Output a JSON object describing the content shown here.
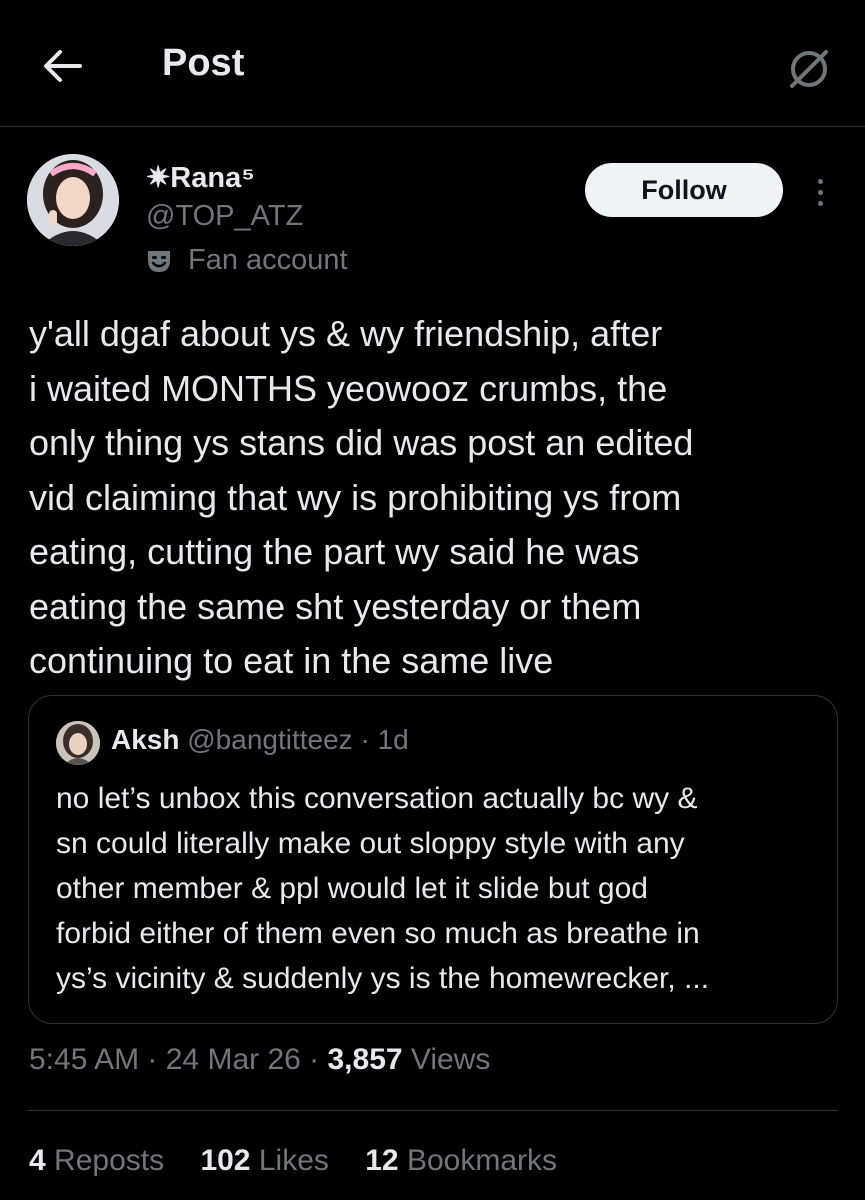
{
  "header": {
    "title": "Post",
    "back_icon": "arrow-left-icon",
    "grok_icon": "grok-icon"
  },
  "author": {
    "display_name": "✷Rana⁵",
    "handle": "@TOP_ATZ",
    "label_icon": "fan-mask-icon",
    "label": "Fan account",
    "follow_label": "Follow",
    "more_icon": "more-vertical-icon"
  },
  "post": {
    "lines": [
      "y'all dgaf about ys & wy friendship, after",
      "i waited MONTHS yeowooz crumbs, the",
      "only thing ys stans did was post an edited",
      "vid claiming that wy is prohibiting ys from",
      "eating, cutting the part wy said he was",
      "eating the same sht yesterday or them",
      "continuing to eat in the same live"
    ]
  },
  "quote": {
    "name": "Aksh",
    "handle": "@bangtitteez",
    "time": "· 1d",
    "lines": [
      "no let’s unbox this conversation actually bc wy &",
      "sn could literally make out sloppy style with any",
      "other member & ppl would let it slide but god",
      "forbid either of them even so much as breathe in",
      "ys’s vicinity & suddenly ys is the homewrecker, ..."
    ]
  },
  "meta": {
    "time": "5:45 AM",
    "date": "24 Mar 26",
    "views_count": "3,857",
    "views_label": "Views"
  },
  "stats": {
    "reposts_count": "4",
    "reposts_label": "Reposts",
    "likes_count": "102",
    "likes_label": "Likes",
    "bookmarks_count": "12",
    "bookmarks_label": "Bookmarks"
  },
  "colors": {
    "background": "#000000",
    "text": "#e7e9ea",
    "secondary": "#71767b",
    "border": "#2f3336",
    "follow_bg": "#eff3f4"
  }
}
